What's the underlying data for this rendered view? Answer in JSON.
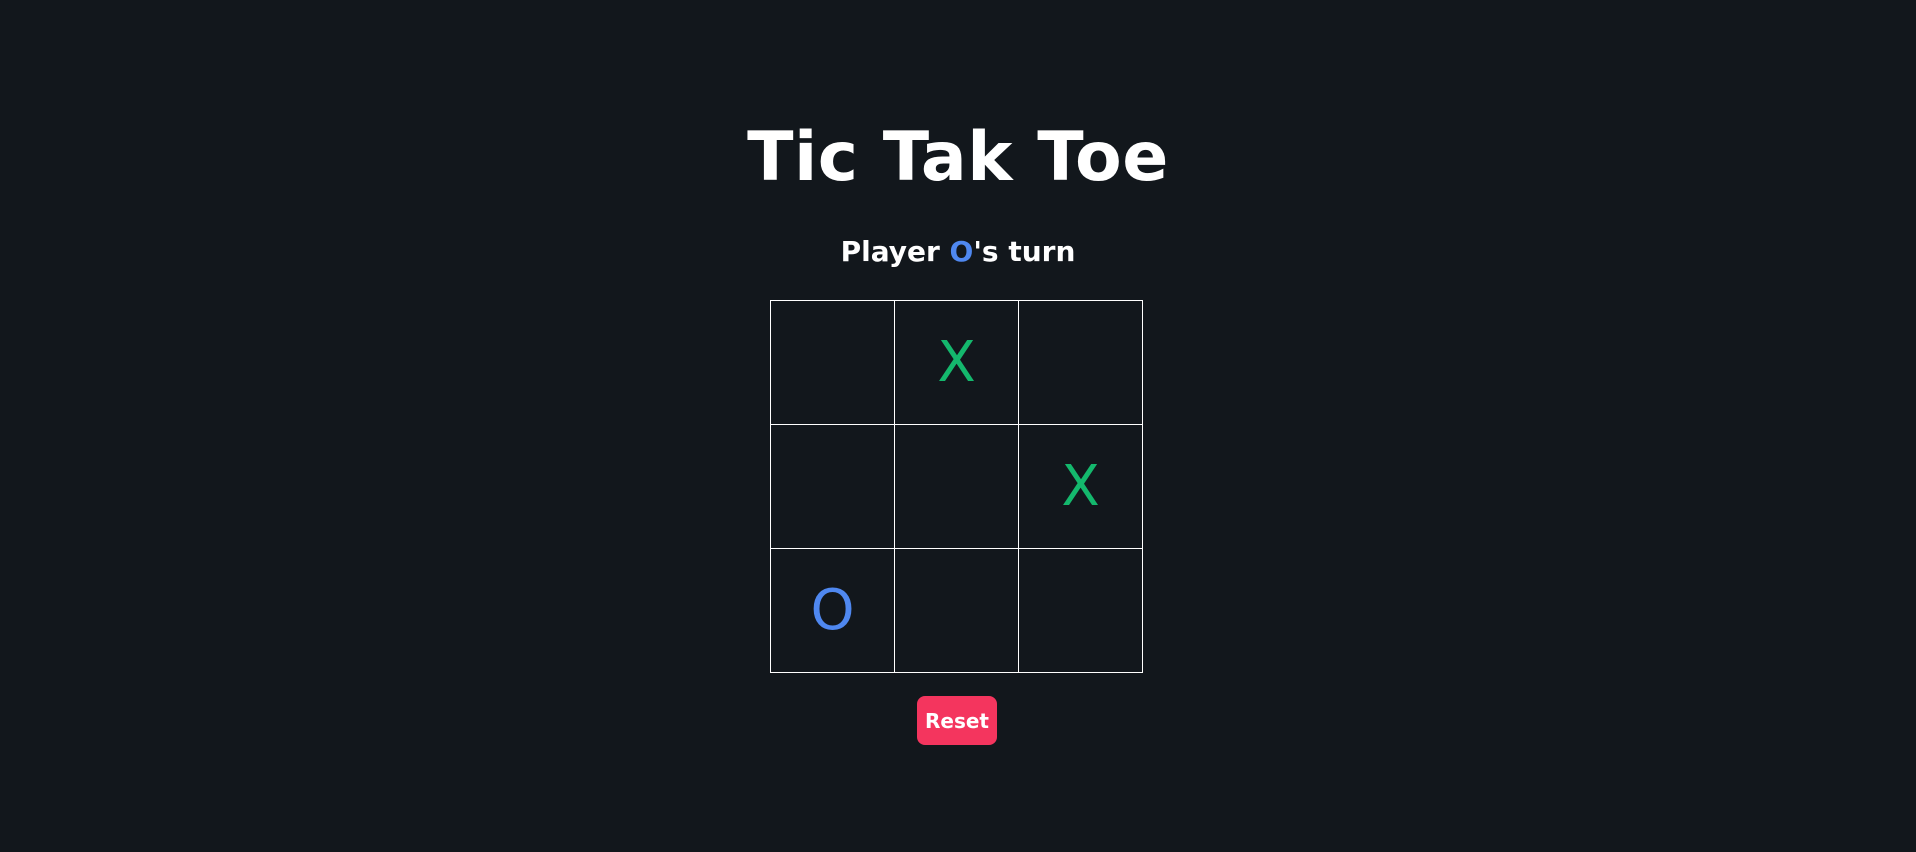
{
  "title": "Tic Tak Toe",
  "status": {
    "prefix": "Player ",
    "player": "O",
    "suffix": "'s turn"
  },
  "board": {
    "cells": [
      "",
      "X",
      "",
      "",
      "",
      "X",
      "O",
      "",
      ""
    ]
  },
  "reset_label": "Reset",
  "colors": {
    "background": "#12171c",
    "x_mark": "#14b86d",
    "o_mark": "#4f88f0",
    "reset_button": "#f4355e"
  }
}
